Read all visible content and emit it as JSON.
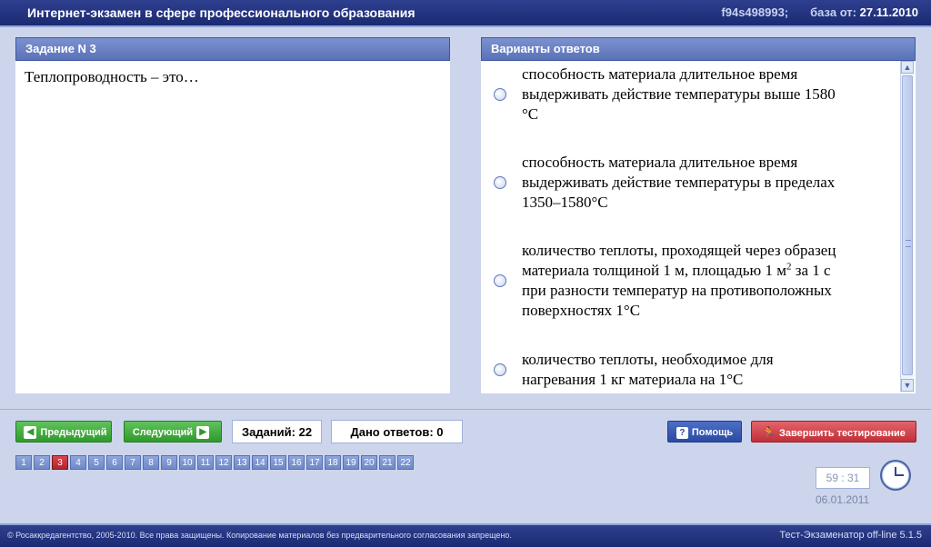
{
  "titlebar": {
    "title": "Интернет-экзамен в сфере профессионального образования",
    "session_id": "f94s498993;",
    "base_label": "база от:",
    "base_date": "27.11.2010"
  },
  "task": {
    "header": "Задание N 3",
    "question": "Теплопроводность – это…"
  },
  "answers": {
    "header": "Варианты ответов",
    "options": [
      {
        "line1": "способность материала длительное время",
        "line2": "выдерживать действие температуры выше 1580",
        "line3": "°С"
      },
      {
        "line1": "способность материала длительное время",
        "line2": "выдерживать действие температуры в пределах",
        "line3": "1350–1580°С"
      },
      {
        "line1": "количество теплоты, проходящей через образец",
        "line2a": "материала толщиной 1 м, площадью 1 м",
        "line2sup": "2",
        "line2b": " за 1 с",
        "line3": "при разности температур на противоположных",
        "line4": "поверхностях 1°С"
      },
      {
        "line1": "количество теплоты, необходимое для",
        "line2": "нагревания 1 кг материала на 1°С"
      }
    ]
  },
  "nav": {
    "prev_label": "Предыдущий",
    "next_label": "Следующий",
    "tasks_label": "Заданий: 22",
    "answered_label": "Дано ответов: 0",
    "help_label": "Помощь",
    "finish_label": "Завершить тестирование"
  },
  "pages": [
    "1",
    "2",
    "3",
    "4",
    "5",
    "6",
    "7",
    "8",
    "9",
    "10",
    "11",
    "12",
    "13",
    "14",
    "15",
    "16",
    "17",
    "18",
    "19",
    "20",
    "21",
    "22"
  ],
  "active_page": "3",
  "timer": "59 : 31",
  "date": "06.01.2011",
  "footer": {
    "copyright": "© Росаккредагентство, 2005-2010. Все права защищены. Копирование материалов без предварительного согласования запрещено.",
    "version": "Тест-Экзаменатор off-line 5.1.5"
  }
}
